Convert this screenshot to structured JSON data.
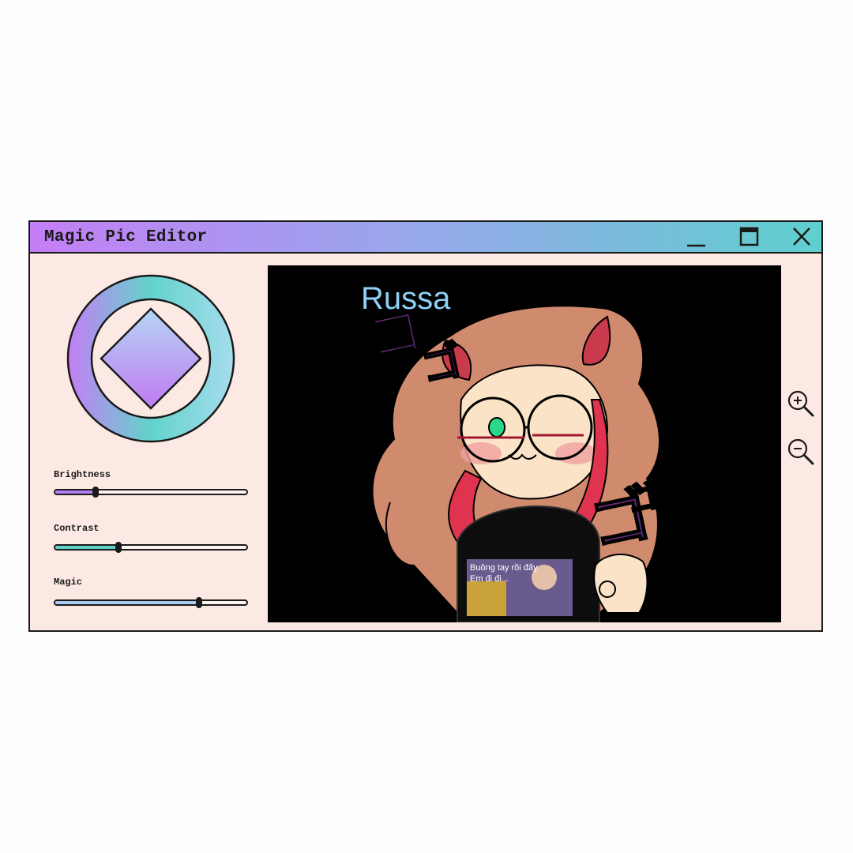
{
  "window": {
    "title": "Magic Pic Editor",
    "controls": [
      "minimize-icon",
      "maximize-icon",
      "close-icon"
    ]
  },
  "colors": {
    "title_gradient": [
      "#c47ef5",
      "#9aa5ec",
      "#5fd0cf"
    ],
    "panel_background": "#fde9e3",
    "brightness_fill": "#b27ef2",
    "contrast_fill": "#5fd0c9",
    "magic_fill": "#a9cbf0"
  },
  "sliders": [
    {
      "label": "Brightness",
      "value": 0.21
    },
    {
      "label": "Contrast",
      "value": 0.33
    },
    {
      "label": "Magic",
      "value": 0.75
    }
  ],
  "canvas": {
    "corner_text": "Russa",
    "shirt_caption_line1": "Buông tay rồi đấy",
    "shirt_caption_line2": "Em đi đi..."
  },
  "zoom": {
    "icons": [
      "zoom-in-icon",
      "zoom-out-icon"
    ]
  }
}
